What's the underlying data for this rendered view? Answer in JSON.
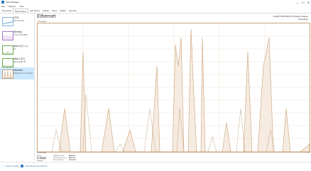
{
  "window": {
    "title": "Task Manager",
    "minimize": "—",
    "maximize": "☐",
    "close": "✕"
  },
  "menu": [
    "File",
    "Options",
    "View"
  ],
  "tabs": [
    "Processes",
    "Performance",
    "App history",
    "Startup",
    "Users",
    "Details",
    "Services"
  ],
  "sidebar": {
    "items": [
      {
        "title": "CPU",
        "sub": "0%  2.20 GHz"
      },
      {
        "title": "Memory",
        "sub": "1.5/4.0 GB (38%)"
      },
      {
        "title": "Disk 0 (C: L:)",
        "sub": "1%"
      },
      {
        "title": "Disk 1 (D:)",
        "sub": "Removable  0%"
      },
      {
        "title": "Ethernet",
        "sub": "Ethernet  S: 0  R: 0 Kbps"
      }
    ]
  },
  "main": {
    "title": "Ethernet",
    "adapter_line1": "Intel(R) PRO/1000 MT Desktop Adapter",
    "adapter_line2": "Throughput",
    "throughput_label": "Throughput",
    "time_label": "60 seconds",
    "zero_label": "0"
  },
  "stats": {
    "send_label": "Send",
    "send_value": "0 Kbps",
    "receive_label": "Receive",
    "receive_value": "0 Kbps"
  },
  "properties": [
    {
      "k": "Adapter name:",
      "v": "Ethernet"
    },
    {
      "k": "Connection type:",
      "v": "Ethernet"
    },
    {
      "k": "IPv4 address:",
      "v": "10.0.2.15"
    },
    {
      "k": "IPv6 address:",
      "v": "fe80::1a2b:3c4d:5e6f:7g8h%3"
    }
  ],
  "footer": {
    "fewer_details": "Fewer details",
    "open_resmon": "Open Resource Monitor"
  },
  "colors": {
    "accent": "#2b7bc2",
    "ethernet_graph": "#c9a27a",
    "ethernet_fill": "#f6ebe0"
  }
}
